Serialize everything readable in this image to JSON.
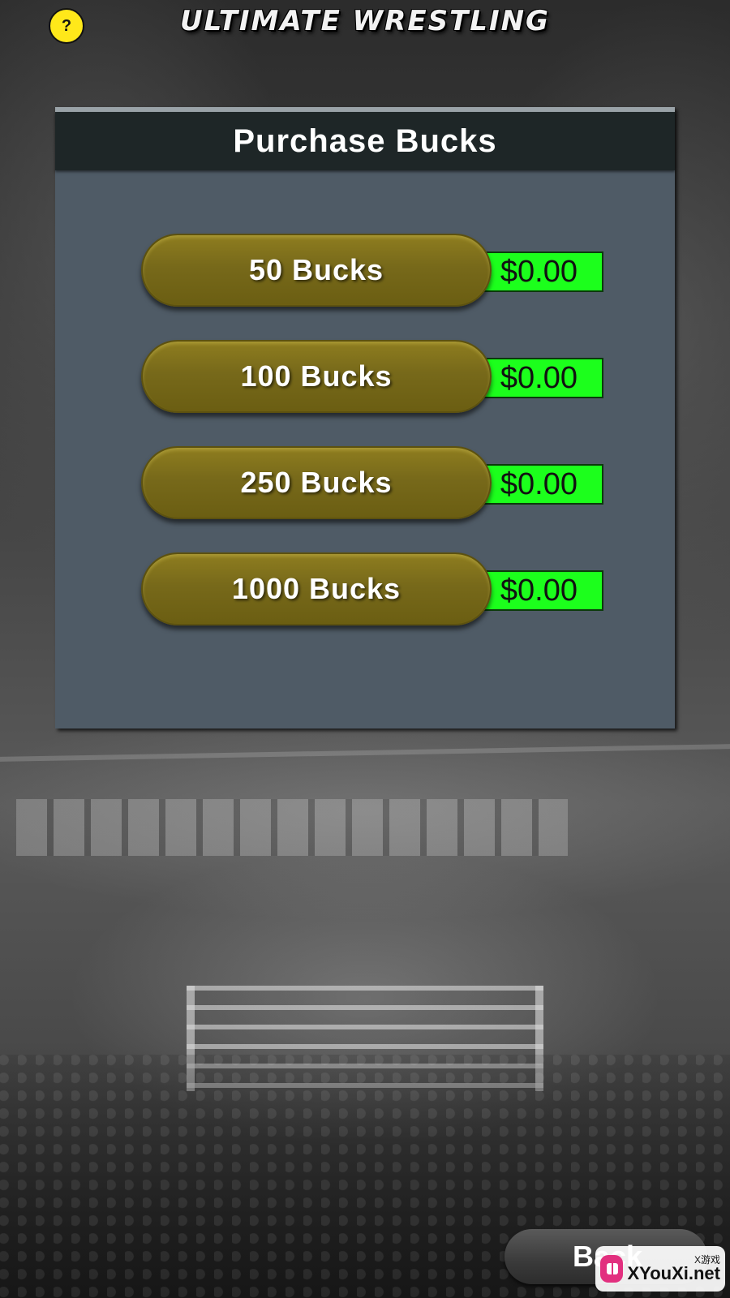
{
  "header": {
    "help_label": "?",
    "logo_text": "ULTIMATE WRESTLING"
  },
  "panel": {
    "title": "Purchase Bucks",
    "items": [
      {
        "label": "50 Bucks",
        "price": "$0.00"
      },
      {
        "label": "100 Bucks",
        "price": "$0.00"
      },
      {
        "label": "250 Bucks",
        "price": "$0.00"
      },
      {
        "label": "1000 Bucks",
        "price": "$0.00"
      }
    ]
  },
  "footer": {
    "back_label": "Back"
  },
  "watermark": {
    "cn": "X游戏",
    "en": "XYouXi.net"
  },
  "colors": {
    "help_button": "#ffe81a",
    "panel_bg": "#4f5b66",
    "panel_header_bg": "#1e2627",
    "buy_button": "#77691a",
    "price_tag": "#1cff1c"
  }
}
